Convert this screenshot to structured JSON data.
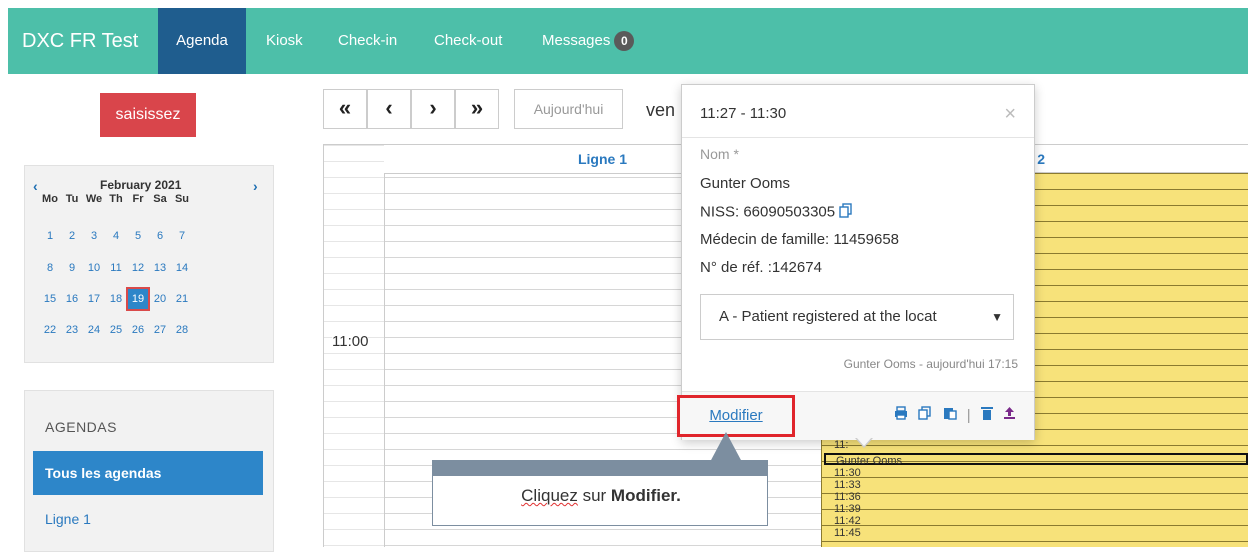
{
  "nav": {
    "brand": "DXC FR Test",
    "items": [
      "Agenda",
      "Kiosk",
      "Check-in",
      "Check-out",
      "Messages"
    ],
    "messages_count": "0"
  },
  "sidebar": {
    "search_button": "saisissez",
    "calendar": {
      "month": "February 2021",
      "weekdays": [
        "Mo",
        "Tu",
        "We",
        "Th",
        "Fr",
        "Sa",
        "Su"
      ],
      "weeks": [
        [
          "1",
          "2",
          "3",
          "4",
          "5",
          "6",
          "7"
        ],
        [
          "8",
          "9",
          "10",
          "11",
          "12",
          "13",
          "14"
        ],
        [
          "15",
          "16",
          "17",
          "18",
          "19",
          "20",
          "21"
        ],
        [
          "22",
          "23",
          "24",
          "25",
          "26",
          "27",
          "28"
        ]
      ],
      "selected": "19"
    },
    "agendas_title": "AGENDAS",
    "agendas_active": "Tous les agendas",
    "agenda_item": "Ligne 1"
  },
  "toolbar": {
    "first": "«",
    "prev": "‹",
    "next": "›",
    "last": "»",
    "today": "Aujourd'hui",
    "date_partial": "ven"
  },
  "grid": {
    "col1": "Ligne 1",
    "col2_partial": "ne 2",
    "time_1100": "11:00",
    "slots": [
      "11:",
      "11:30",
      "11:33",
      "11:36",
      "11:39",
      "11:42",
      "11:45"
    ],
    "appointment": "Gunter Ooms"
  },
  "popover": {
    "time": "11:27 - 11:30",
    "name_label": "Nom *",
    "name": "Gunter Ooms",
    "niss": "NISS: 66090503305",
    "doctor": "Médecin de famille: 11459658",
    "ref": "N° de réf. :142674",
    "status_selected": "A - Patient registered at the locat",
    "meta": "Gunter Ooms - aujourd'hui 17:15",
    "modify": "Modifier"
  },
  "callout": {
    "prefix": "Cliquez",
    "middle": " sur ",
    "bold": "Modifier."
  },
  "colors": {
    "nav_bg": "#4dbfa9",
    "nav_active": "#1f5d8e",
    "red_button": "#d9454b",
    "accent_blue": "#2d86c9",
    "appointment_yellow": "#f7e27a",
    "highlight_red": "#e0252b"
  }
}
